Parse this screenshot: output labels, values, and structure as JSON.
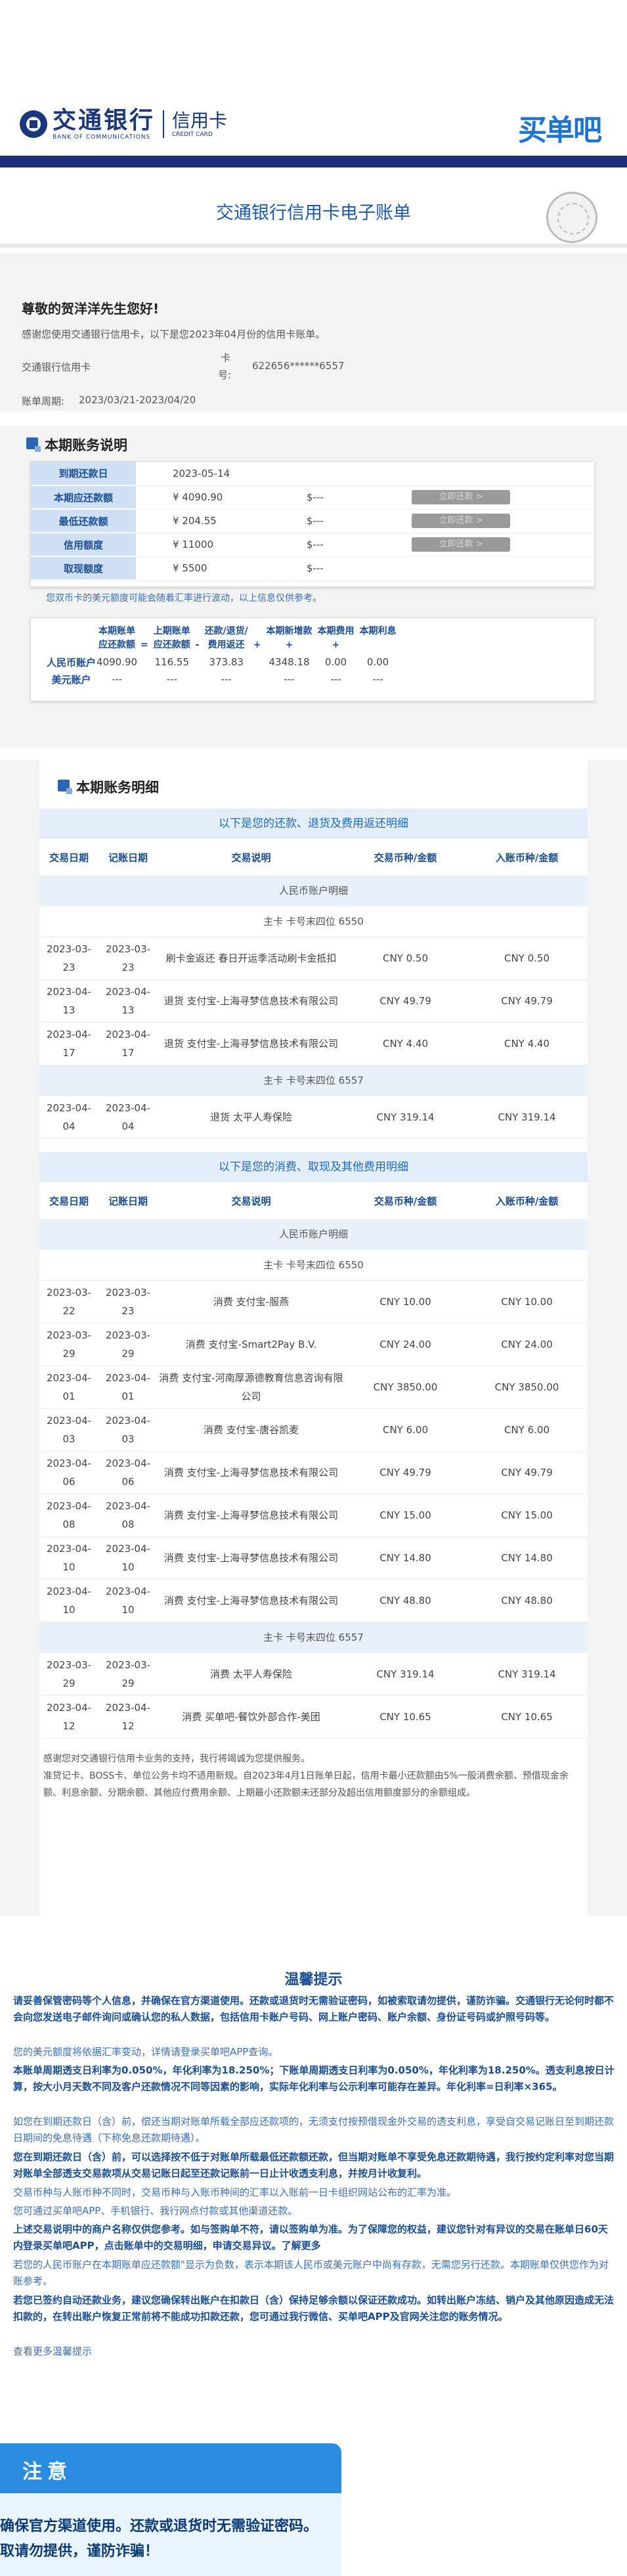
{
  "header": {
    "logo_cn": "交通银行",
    "logo_en": "BANK OF COMMUNICATIONS",
    "card_cn": "信用卡",
    "card_en": "CREDIT CARD",
    "brand": "买单吧"
  },
  "title": "交通银行信用卡电子账单",
  "greeting": {
    "hello": "尊敬的贺洋洋先生您好!",
    "intro": "感谢您使用交通银行信用卡，以下是您2023年04月份的信用卡账单。",
    "card_label": "交通银行信用卡",
    "card_no_label_1": "卡",
    "card_no_label_2": "号:",
    "card_no": "622656******6557",
    "period_label": "账单周期:",
    "period": "2023/03/21-2023/04/20"
  },
  "summary": {
    "title": "本期账务说明",
    "rows": [
      {
        "label": "到期还款日",
        "value": "2023-05-14",
        "dollar": "",
        "btn": ""
      },
      {
        "label": "本期应还款额",
        "value": "¥ 4090.90",
        "dollar": "$---",
        "btn": "立即还款 >"
      },
      {
        "label": "最低还款额",
        "value": "¥ 204.55",
        "dollar": "$---",
        "btn": "立即还款 >"
      },
      {
        "label": "信用额度",
        "value": "¥ 11000",
        "dollar": "$---",
        "btn": "立即还款 >"
      },
      {
        "label": "取现额度",
        "value": "¥ 5500",
        "dollar": "$---",
        "btn": ""
      }
    ],
    "note": "您双币卡的美元额度可能会随着汇率进行波动，以上信息仅供参考。",
    "calc": {
      "h_cur": "本期账单",
      "h_cur2": "应还款额",
      "h_prev": "上期账单",
      "h_prev2": "应还款额",
      "h_repay": "还款/退货/",
      "h_repay2": "费用返还",
      "h_new": "本期新增款",
      "h_fee": "本期费用",
      "h_int": "本期利息",
      "op1": "=",
      "op2": "-",
      "op3": "+",
      "op4": "+",
      "op5": "+",
      "rmb_label": "人民币账户",
      "usd_label": "美元账户",
      "rmb": [
        "4090.90",
        "116.55",
        "373.83",
        "4348.18",
        "0.00",
        "0.00"
      ],
      "usd": [
        "---",
        "---",
        "---",
        "---",
        "---",
        "---"
      ]
    }
  },
  "detail": {
    "title": "本期账务明细",
    "repay_banner": "以下是您的还款、退货及费用返还明细",
    "spend_banner": "以下是您的消费、取现及其他费用明细",
    "cols": [
      "交易日期",
      "记账日期",
      "交易说明",
      "交易币种/金额",
      "入账币种/金额"
    ],
    "rmb_group": "人民币账户明细",
    "card6550": "主卡 卡号末四位 6550",
    "card6557": "主卡 卡号末四位 6557",
    "repay_rows_6550": [
      {
        "d1": "2023-03-23",
        "d2": "2023-03-23",
        "desc": "刷卡金返还 春日开运季活动刷卡金抵扣",
        "amt": "CNY 0.50",
        "post": "CNY 0.50"
      },
      {
        "d1": "2023-04-13",
        "d2": "2023-04-13",
        "desc": "退货 支付宝-上海寻梦信息技术有限公司",
        "amt": "CNY 49.79",
        "post": "CNY 49.79"
      },
      {
        "d1": "2023-04-17",
        "d2": "2023-04-17",
        "desc": "退货 支付宝-上海寻梦信息技术有限公司",
        "amt": "CNY 4.40",
        "post": "CNY 4.40"
      }
    ],
    "repay_rows_6557": [
      {
        "d1": "2023-04-04",
        "d2": "2023-04-04",
        "desc": "退货 太平人寿保险",
        "amt": "CNY 319.14",
        "post": "CNY 319.14"
      }
    ],
    "spend_rows_6550": [
      {
        "d1": "2023-03-22",
        "d2": "2023-03-23",
        "desc": "消费 支付宝-服燕",
        "amt": "CNY 10.00",
        "post": "CNY 10.00"
      },
      {
        "d1": "2023-03-29",
        "d2": "2023-03-29",
        "desc": "消费 支付宝-Smart2Pay B.V.",
        "amt": "CNY 24.00",
        "post": "CNY 24.00"
      },
      {
        "d1": "2023-04-01",
        "d2": "2023-04-01",
        "desc": "消费 支付宝-河南厚源德教育信息咨询有限公司",
        "amt": "CNY 3850.00",
        "post": "CNY 3850.00"
      },
      {
        "d1": "2023-04-03",
        "d2": "2023-04-03",
        "desc": "消费 支付宝-唐谷凯麦",
        "amt": "CNY 6.00",
        "post": "CNY 6.00"
      },
      {
        "d1": "2023-04-06",
        "d2": "2023-04-06",
        "desc": "消费 支付宝-上海寻梦信息技术有限公司",
        "amt": "CNY 49.79",
        "post": "CNY 49.79"
      },
      {
        "d1": "2023-04-08",
        "d2": "2023-04-08",
        "desc": "消费 支付宝-上海寻梦信息技术有限公司",
        "amt": "CNY 15.00",
        "post": "CNY 15.00"
      },
      {
        "d1": "2023-04-10",
        "d2": "2023-04-10",
        "desc": "消费 支付宝-上海寻梦信息技术有限公司",
        "amt": "CNY 14.80",
        "post": "CNY 14.80"
      },
      {
        "d1": "2023-04-10",
        "d2": "2023-04-10",
        "desc": "消费 支付宝-上海寻梦信息技术有限公司",
        "amt": "CNY 48.80",
        "post": "CNY 48.80"
      }
    ],
    "spend_rows_6557": [
      {
        "d1": "2023-03-29",
        "d2": "2023-03-29",
        "desc": "消费 太平人寿保险",
        "amt": "CNY 319.14",
        "post": "CNY 319.14"
      },
      {
        "d1": "2023-04-12",
        "d2": "2023-04-12",
        "desc": "消费 买单吧-餐饮外部合作-美团",
        "amt": "CNY 10.65",
        "post": "CNY 10.65"
      }
    ],
    "footer1": "感谢您对交通银行信用卡业务的支持，我行将竭诚为您提供服务。",
    "footer2": "准贷记卡、BOSS卡、单位公务卡均不适用新规。自2023年4月1日账单日起，信用卡最小还款额由5%一般消费余额、预借现金余额、利息余额、分期余额、其他应付费用余额、上期最小还款额未还部分及超出信用额度部分的余额组成。"
  },
  "tips": {
    "title": "温馨提示",
    "l1": "请妥善保管密码等个人信息，并确保在官方渠道使用。还款或退货时无需验证密码，如被索取请勿提供，谨防诈骗。交通银行无论何时都不会向您发送电子邮件询问或确认您的私人数据，包括信用卡账户号码、网上账户密码、账户余额、身份证号码或护照号码等。",
    "l2": "您的美元额度将依据汇率变动，详情请登录买单吧APP查询。",
    "l3": "本账单周期透支日利率为0.050%，年化利率为18.250%；下账单周期透支日利率为0.050%，年化利率为18.250%。透支利息按日计算，按大小月天数不同及客户还款情况不同等因素的影响，实际年化利率与公示利率可能存在差异。年化利率=日利率×365。",
    "l4": "如您在到期还款日（含）前，偿还当期对账单所载全部应还款项的，无须支付按预借现金外交易的透支利息，享受自交易记账日至到期还款日期间的免息待遇（下称免息还款期待遇）。",
    "l5": "您在到期还款日（含）前，可以选择按不低于对账单所载最低还款额还款，但当期对账单不享受免息还款期待遇，我行按约定利率对您当期对账单全部透支交易款项从交易记账日起至还款记账前一日止计收透支利息，并按月计收复利。",
    "l6": "交易币种与人账币种不同时，交易币种与入账币种间的汇率以入账前一日卡组织网站公布的汇率为准。",
    "l7": "您可通过买单吧APP、手机银行、我行网点付款或其他渠道还款。",
    "l8": "上述交易说明中的商户名称仅供您参考。如与签购单不符，请以签购单为准。为了保障您的权益，建议您针对有异议的交易在账单日60天内登录买单吧APP，点击账单中的交易明细，申请交易异议。了解更多",
    "l9": "若您的人民币账户在本期账单应还款额\"显示为负数，表示本期该人民币或美元账户中尚有存款，无需您另行还款。本期账单仅供您作为对账参考。",
    "l10": "若您已签约自动还款业务，建议您确保转出账户在扣款日（含）保持足够余额以保证还款成功。如转出账户冻结、销户及其他原因造成无法扣款的，在转出账户恢复正常前将不能成功扣款还款，您可通过我行微信、买单吧APP及官网关注您的账务情况。",
    "l11": "查看更多温馨提示"
  },
  "notice": {
    "title": "注意",
    "l1": "确保官方渠道使用。还款或退货时无需验证密码。",
    "l2": "取请勿提供，谨防诈骗！"
  }
}
